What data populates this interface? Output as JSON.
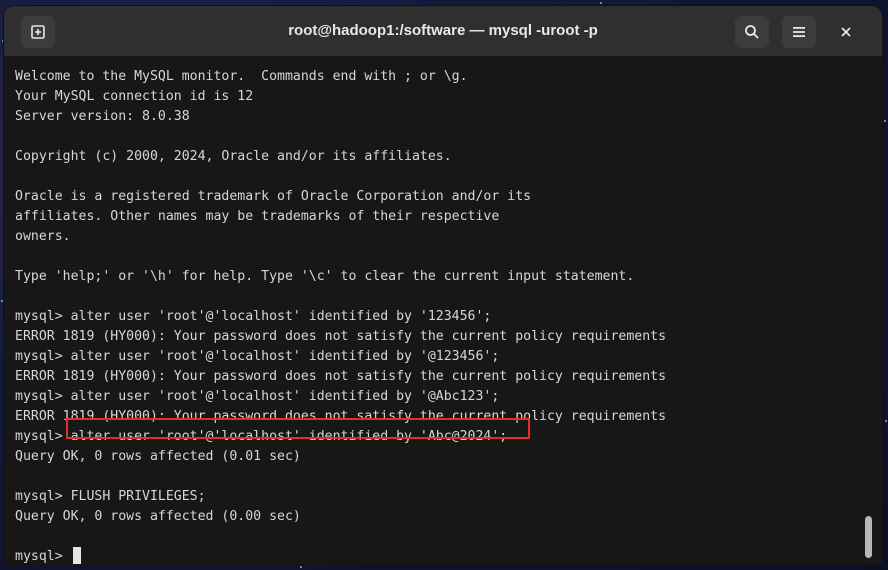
{
  "window": {
    "title": "root@hadoop1:/software — mysql -uroot -p",
    "buttons": {
      "new_tab_icon": "new-tab-icon",
      "search_icon": "search-icon",
      "menu_icon": "hamburger-menu-icon",
      "close_icon": "close-icon"
    }
  },
  "terminal": {
    "lines": [
      "Welcome to the MySQL monitor.  Commands end with ; or \\g.",
      "Your MySQL connection id is 12",
      "Server version: 8.0.38",
      "",
      "Copyright (c) 2000, 2024, Oracle and/or its affiliates.",
      "",
      "Oracle is a registered trademark of Oracle Corporation and/or its",
      "affiliates. Other names may be trademarks of their respective",
      "owners.",
      "",
      "Type 'help;' or '\\h' for help. Type '\\c' to clear the current input statement.",
      "",
      "mysql> alter user 'root'@'localhost' identified by '123456';",
      "ERROR 1819 (HY000): Your password does not satisfy the current policy requirements",
      "mysql> alter user 'root'@'localhost' identified by '@123456';",
      "ERROR 1819 (HY000): Your password does not satisfy the current policy requirements",
      "mysql> alter user 'root'@'localhost' identified by '@Abc123';",
      "ERROR 1819 (HY000): Your password does not satisfy the current policy requirements",
      "mysql> alter user 'root'@'localhost' identified by 'Abc@2024';",
      "Query OK, 0 rows affected (0.01 sec)",
      "",
      "mysql> FLUSH PRIVILEGES;",
      "Query OK, 0 rows affected (0.00 sec)",
      "",
      "mysql> "
    ],
    "highlight_color": "#e0302b"
  }
}
